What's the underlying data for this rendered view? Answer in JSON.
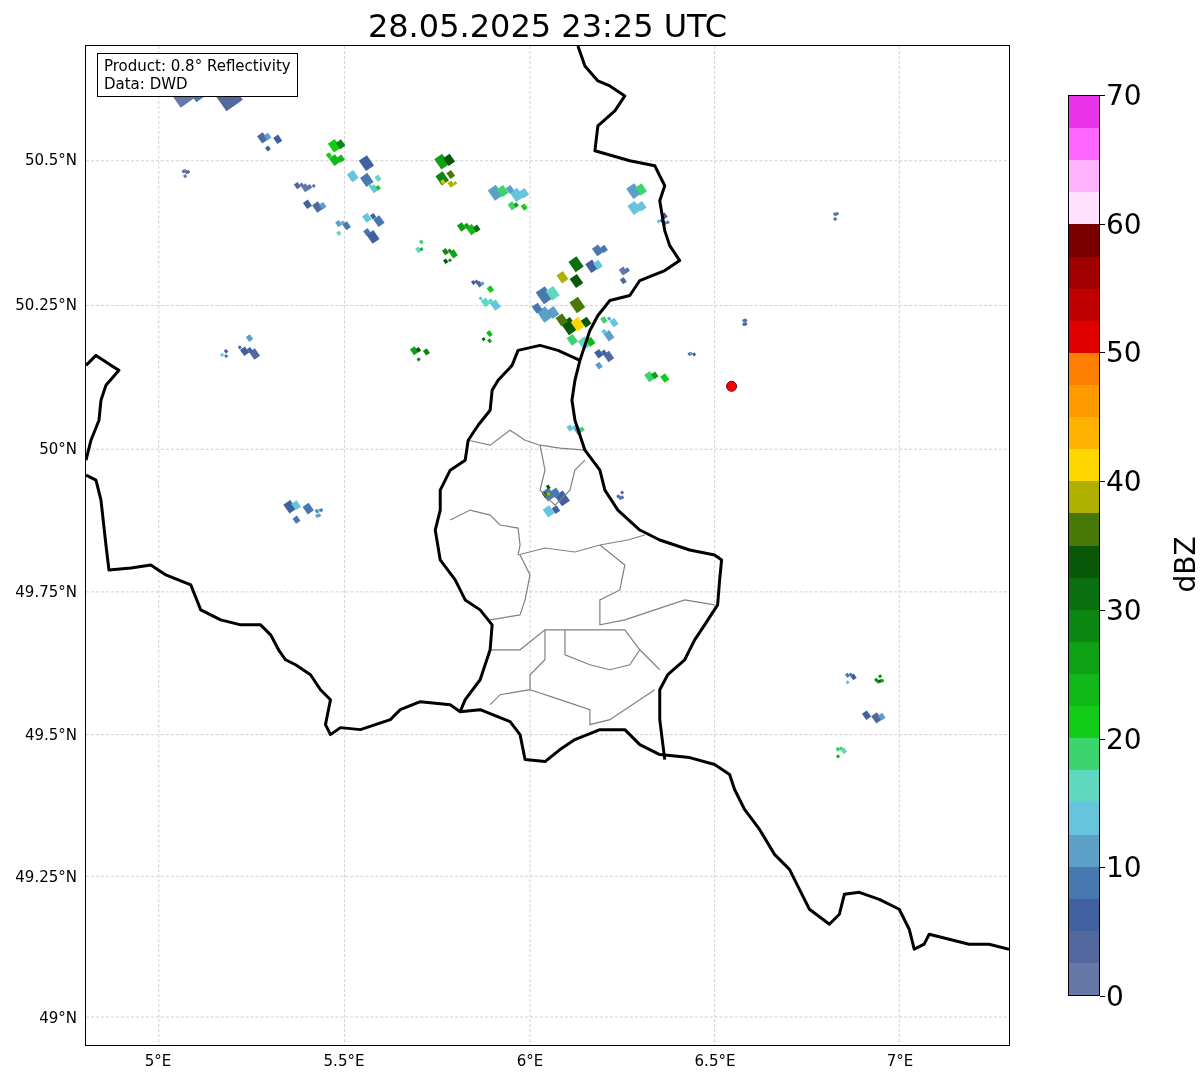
{
  "title": "28.05.2025 23:25 UTC",
  "info_box": {
    "lines": [
      "Product: 0.8° Reflectivity",
      "Data: DWD"
    ]
  },
  "map": {
    "y_ticks": [
      "50.5°N",
      "50.25°N",
      "50°N",
      "49.75°N",
      "49.5°N",
      "49.25°N",
      "49°N"
    ],
    "x_ticks": [
      "5°E",
      "5.5°E",
      "6°E",
      "6.5°E",
      "7°E"
    ]
  },
  "colorbar": {
    "label": "dBZ",
    "ticks": [
      "70",
      "60",
      "50",
      "40",
      "30",
      "20",
      "10",
      "0"
    ],
    "segments": [
      {
        "color": "#e833e8"
      },
      {
        "color": "#ff66ff"
      },
      {
        "color": "#ffb3ff"
      },
      {
        "color": "#ffe0ff"
      },
      {
        "color": "#7a0000"
      },
      {
        "color": "#a00000"
      },
      {
        "color": "#c00000"
      },
      {
        "color": "#e00000"
      },
      {
        "color": "#ff8000"
      },
      {
        "color": "#ff9900"
      },
      {
        "color": "#ffb300"
      },
      {
        "color": "#ffd700"
      },
      {
        "color": "#b0b000"
      },
      {
        "color": "#487808"
      },
      {
        "color": "#085808"
      },
      {
        "color": "#0a700f"
      },
      {
        "color": "#0c8812"
      },
      {
        "color": "#0ea015"
      },
      {
        "color": "#10b818"
      },
      {
        "color": "#12cc18"
      },
      {
        "color": "#3cd46c"
      },
      {
        "color": "#60d8c0"
      },
      {
        "color": "#66c4dc"
      },
      {
        "color": "#5ca0c8"
      },
      {
        "color": "#4878b0"
      },
      {
        "color": "#4060a0"
      },
      {
        "color": "#5468a0"
      },
      {
        "color": "#6678a8"
      }
    ]
  }
}
